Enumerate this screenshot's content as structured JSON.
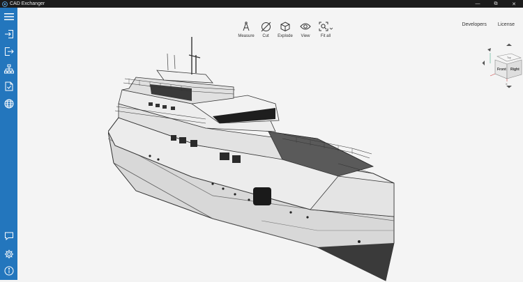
{
  "window": {
    "title": "CAD Exchanger",
    "controls": {
      "minimize": "—",
      "maximize": "⧉",
      "close": "✕"
    }
  },
  "sidebar": {
    "items": [
      {
        "name": "menu",
        "icon": "hamburger-menu-icon"
      },
      {
        "name": "import",
        "icon": "import-icon"
      },
      {
        "name": "export",
        "icon": "export-icon"
      },
      {
        "name": "structure",
        "icon": "model-tree-icon"
      },
      {
        "name": "properties",
        "icon": "document-properties-icon"
      },
      {
        "name": "web",
        "icon": "globe-icon"
      }
    ],
    "bottom_items": [
      {
        "name": "feedback",
        "icon": "chat-bubble-icon"
      },
      {
        "name": "settings",
        "icon": "gear-icon"
      },
      {
        "name": "about",
        "icon": "info-icon"
      }
    ]
  },
  "toolbar": {
    "measure_label": "Measure",
    "cut_label": "Cut",
    "explode_label": "Explode",
    "view_label": "View",
    "fitall_label": "Fit all"
  },
  "links": {
    "developers_label": "Developers",
    "license_label": "License"
  },
  "viewcube": {
    "front_label": "Front",
    "right_label": "Right",
    "top_label": "Top",
    "axis_x_label": "X"
  },
  "colors": {
    "sidebar": "#2376bd",
    "titlebar": "#1c1c1c",
    "viewport_bg": "#f4f4f4"
  }
}
